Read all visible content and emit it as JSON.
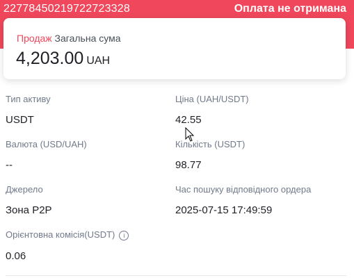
{
  "header": {
    "order_id": "22778450219722723328",
    "status": "Оплата не отримана"
  },
  "summary": {
    "side": "Продаж",
    "label": "Загальна сума",
    "amount": "4,203.00",
    "currency": "UAH"
  },
  "details": {
    "asset_type": {
      "label": "Тип активу",
      "value": "USDT"
    },
    "price": {
      "label": "Ціна (UAH/USDT)",
      "value": "42.55"
    },
    "currency_rate": {
      "label": "Валюта (USD/UAH)",
      "value": "--"
    },
    "quantity": {
      "label": "Кількість (USDT)",
      "value": "98.77"
    },
    "source": {
      "label": "Джерело",
      "value": "Зона P2P"
    },
    "match_time": {
      "label": "Час пошуку відповідного ордера",
      "value": "2025-07-15 17:49:59"
    },
    "fee": {
      "label": "Орієнтовна комісія(USDT)",
      "value": "0.06",
      "icon": "info-icon"
    }
  },
  "colors": {
    "banner": "#f0475c",
    "sell": "#f0475c",
    "label": "#707a8a",
    "text": "#1e2026"
  }
}
